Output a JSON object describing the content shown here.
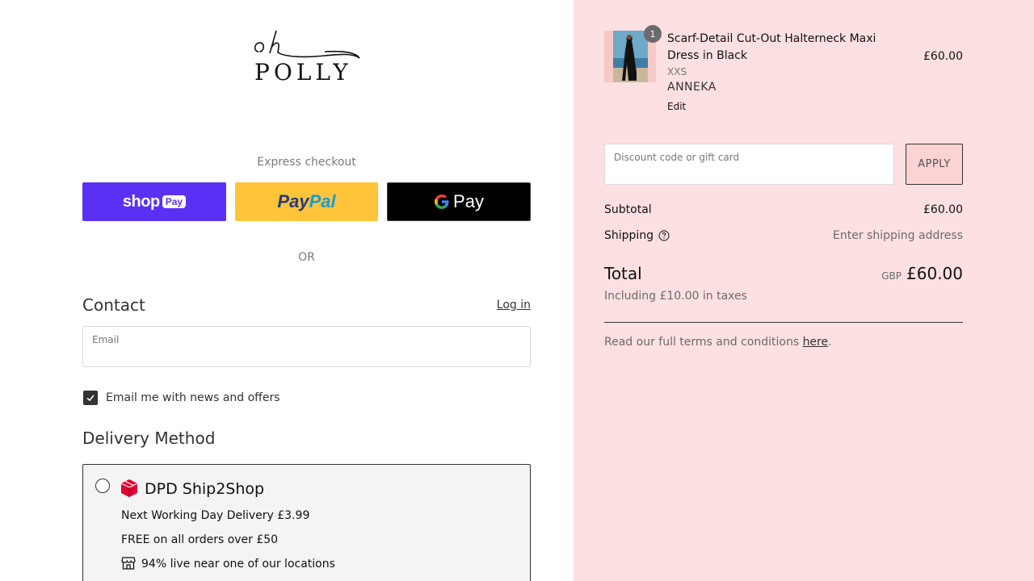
{
  "brand": {
    "logo_script": "oh",
    "logo_word": "POLLY"
  },
  "express": {
    "label": "Express checkout",
    "shop_pay": {
      "word": "shop",
      "pill": "Pay"
    },
    "paypal": {
      "part1": "Pay",
      "part2": "Pal"
    },
    "gpay": {
      "word": "Pay"
    }
  },
  "or_label": "OR",
  "contact": {
    "title": "Contact",
    "login_link": "Log in",
    "email_label": "Email",
    "email_value": "",
    "newsletter_label": "Email me with news and offers",
    "newsletter_checked": true
  },
  "delivery": {
    "title": "Delivery Method",
    "options": [
      {
        "name": "DPD Ship2Shop",
        "line1": "Next Working Day Delivery £3.99",
        "line2": "FREE on all orders over £50",
        "line3": "94% live near one of our locations",
        "icon": "dpd-cube-icon",
        "selected": false
      }
    ]
  },
  "cart": {
    "items": [
      {
        "quantity": "1",
        "name": "Scarf-Detail Cut-Out Halterneck Maxi Dress in Black",
        "size": "XXS",
        "model": "ANNEKA",
        "edit_label": "Edit",
        "price": "£60.00"
      }
    ],
    "discount_label": "Discount code or gift card",
    "discount_value": "",
    "apply_label": "APPLY",
    "subtotal_label": "Subtotal",
    "subtotal_value": "£60.00",
    "shipping_label": "Shipping",
    "shipping_value": "Enter shipping address",
    "total_label": "Total",
    "total_currency": "GBP",
    "total_value": "£60.00",
    "taxes_text": "Including £10.00 in taxes",
    "terms_text": "Read our full terms and conditions ",
    "terms_link": "here",
    "terms_end": "."
  },
  "colors": {
    "summary_bg": "#fde0e2",
    "shop_pay": "#5a31f4",
    "paypal": "#ffc439",
    "gpay": "#000000",
    "dpd_red": "#dc0032"
  }
}
